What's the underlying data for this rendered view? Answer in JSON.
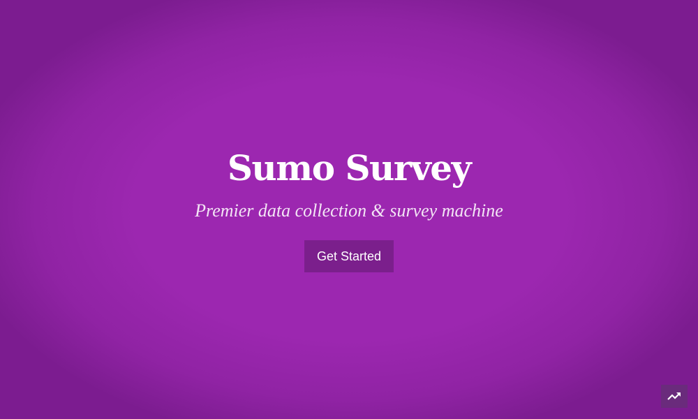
{
  "hero": {
    "title": "Sumo Survey",
    "subtitle": "Premier data collection & survey machine",
    "cta_label": "Get Started"
  },
  "corner_button": {
    "icon": "trending-up-icon"
  },
  "colors": {
    "background": "#9c27b0",
    "button": "#7b1f8c",
    "corner_button": "#6a2b7c",
    "text": "#ffffff"
  }
}
